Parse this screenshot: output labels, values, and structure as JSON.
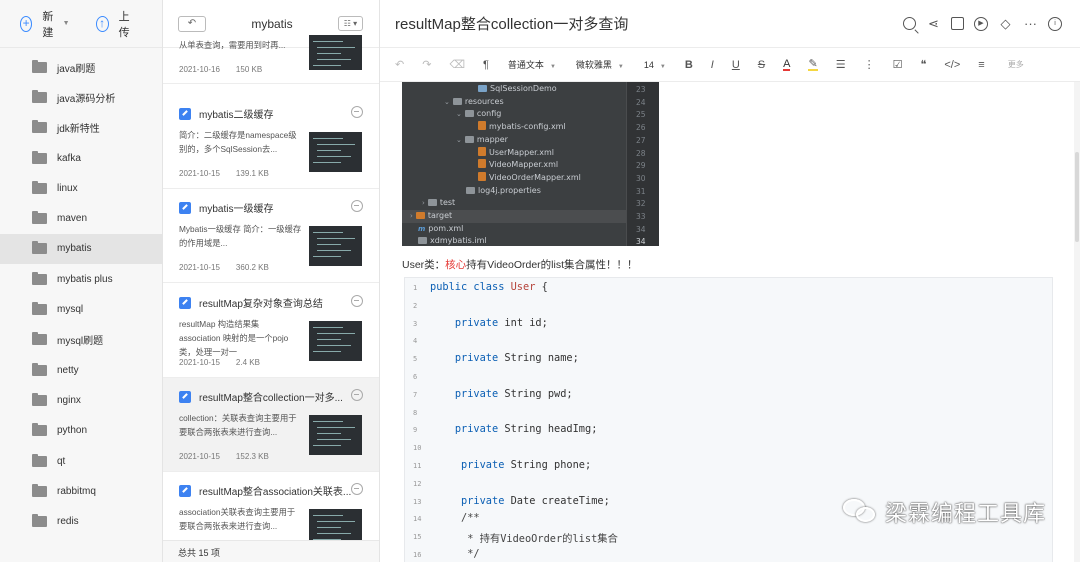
{
  "sidebar": {
    "new_label": "新建",
    "upload_label": "上传",
    "folders": [
      {
        "label": "java刷题"
      },
      {
        "label": "java源码分析"
      },
      {
        "label": "jdk新特性"
      },
      {
        "label": "kafka"
      },
      {
        "label": "linux"
      },
      {
        "label": "maven"
      },
      {
        "label": "mybatis",
        "active": true
      },
      {
        "label": "mybatis plus"
      },
      {
        "label": "mysql"
      },
      {
        "label": "mysql刷题"
      },
      {
        "label": "netty"
      },
      {
        "label": "nginx"
      },
      {
        "label": "python"
      },
      {
        "label": "qt"
      },
      {
        "label": "rabbitmq"
      },
      {
        "label": "redis"
      }
    ]
  },
  "notelist": {
    "back_glyph": "↶",
    "title": "mybatis",
    "view_glyph": "☷ ▾",
    "footer": "总共 15 项",
    "notes": [
      {
        "title": "",
        "snippet": "从单表查询，需要用到时再...",
        "date": "2021-10-16",
        "size": "150 KB"
      },
      {
        "title": "mybatis二级缓存",
        "snippet": "简介：二级缓存是namespace级别的，多个SqlSession去...",
        "date": "2021-10-15",
        "size": "139.1 KB"
      },
      {
        "title": "mybatis一级缓存",
        "snippet": "Mybatis一级缓存 简介：一级缓存的作用域是...",
        "date": "2021-10-15",
        "size": "360.2 KB"
      },
      {
        "title": "resultMap复杂对象查询总结",
        "snippet": "resultMap 构造结果集 association 映射的是一个pojo类，处理一对一",
        "date": "2021-10-15",
        "size": "2.4 KB"
      },
      {
        "title": "resultMap整合collection一对多...",
        "snippet": "collection：关联表查询主要用于要联合两张表来进行查询...",
        "date": "2021-10-15",
        "size": "152.3 KB",
        "active": true
      },
      {
        "title": "resultMap整合association关联表...",
        "snippet": "association关联表查询主要用于要联合两张表来进行查询...",
        "date": "",
        "size": ""
      }
    ]
  },
  "editor": {
    "title": "resultMap整合collection一对多查询",
    "toolbar": {
      "paragraph_style": "普通文本",
      "font_family": "微软雅黑",
      "font_size": "14",
      "more": "更多"
    },
    "ide": {
      "rows": [
        {
          "text": "SqlSessionDemo",
          "indent": 76,
          "icon": "src",
          "line": "23"
        },
        {
          "text": "resources",
          "indent": 42,
          "icon": "tf",
          "tri": "⌄",
          "line": "24"
        },
        {
          "text": "config",
          "indent": 54,
          "icon": "tf",
          "tri": "⌄",
          "line": "25"
        },
        {
          "text": "mybatis-config.xml",
          "indent": 76,
          "icon": "xml",
          "line": "26"
        },
        {
          "text": "mapper",
          "indent": 54,
          "icon": "tf",
          "tri": "⌄",
          "line": "27"
        },
        {
          "text": "UserMapper.xml",
          "indent": 76,
          "icon": "xml",
          "line": "28"
        },
        {
          "text": "VideoMapper.xml",
          "indent": 76,
          "icon": "xml",
          "line": "29"
        },
        {
          "text": "VideoOrderMapper.xml",
          "indent": 76,
          "icon": "xml",
          "line": "30"
        },
        {
          "text": "log4j.properties",
          "indent": 64,
          "icon": "tf",
          "line": "31"
        },
        {
          "text": "test",
          "indent": 20,
          "icon": "tf",
          "tri": "›",
          "line": "32"
        },
        {
          "text": "target",
          "indent": 8,
          "icon": "or",
          "tri": "›",
          "line": "33",
          "sel": true
        },
        {
          "text": "pom.xml",
          "indent": 16,
          "icon": "m",
          "line": "34"
        },
        {
          "text": "xdmybatis.iml",
          "indent": 16,
          "icon": "tf",
          "line": ""
        }
      ],
      "extra_line": "34"
    },
    "user_text": {
      "prefix": "User类：",
      "highlight": "核心",
      "suffix": "持有VideoOrder的list集合属性！！！"
    },
    "code_lines": [
      {
        "n": "1",
        "parts": [
          [
            "kw",
            "public class "
          ],
          [
            "ty",
            "User"
          ],
          [
            "",
            " {"
          ]
        ]
      },
      {
        "n": "2",
        "parts": []
      },
      {
        "n": "3",
        "parts": [
          [
            "",
            "    "
          ],
          [
            "kw",
            "private"
          ],
          [
            "",
            " int id;"
          ]
        ]
      },
      {
        "n": "4",
        "parts": []
      },
      {
        "n": "5",
        "parts": [
          [
            "",
            "    "
          ],
          [
            "kw",
            "private"
          ],
          [
            "",
            " String name;"
          ]
        ]
      },
      {
        "n": "6",
        "parts": []
      },
      {
        "n": "7",
        "parts": [
          [
            "",
            "    "
          ],
          [
            "kw",
            "private"
          ],
          [
            "",
            " String pwd;"
          ]
        ]
      },
      {
        "n": "8",
        "parts": []
      },
      {
        "n": "9",
        "parts": [
          [
            "",
            "    "
          ],
          [
            "kw",
            "private"
          ],
          [
            "",
            " String headImg;"
          ]
        ]
      },
      {
        "n": "10",
        "parts": []
      },
      {
        "n": "11",
        "parts": [
          [
            "",
            "     "
          ],
          [
            "kw",
            "private"
          ],
          [
            "",
            " String phone;"
          ]
        ]
      },
      {
        "n": "12",
        "parts": []
      },
      {
        "n": "13",
        "parts": [
          [
            "",
            "     "
          ],
          [
            "kw",
            "private"
          ],
          [
            "",
            " Date createTime;"
          ]
        ]
      },
      {
        "n": "14",
        "parts": [
          [
            "cm",
            "     /**"
          ]
        ]
      },
      {
        "n": "15",
        "parts": [
          [
            "cm",
            "      * 持有VideoOrder的list集合"
          ]
        ]
      },
      {
        "n": "16",
        "parts": [
          [
            "cm",
            "      */"
          ]
        ]
      }
    ]
  },
  "watermark": "梁霖编程工具库"
}
